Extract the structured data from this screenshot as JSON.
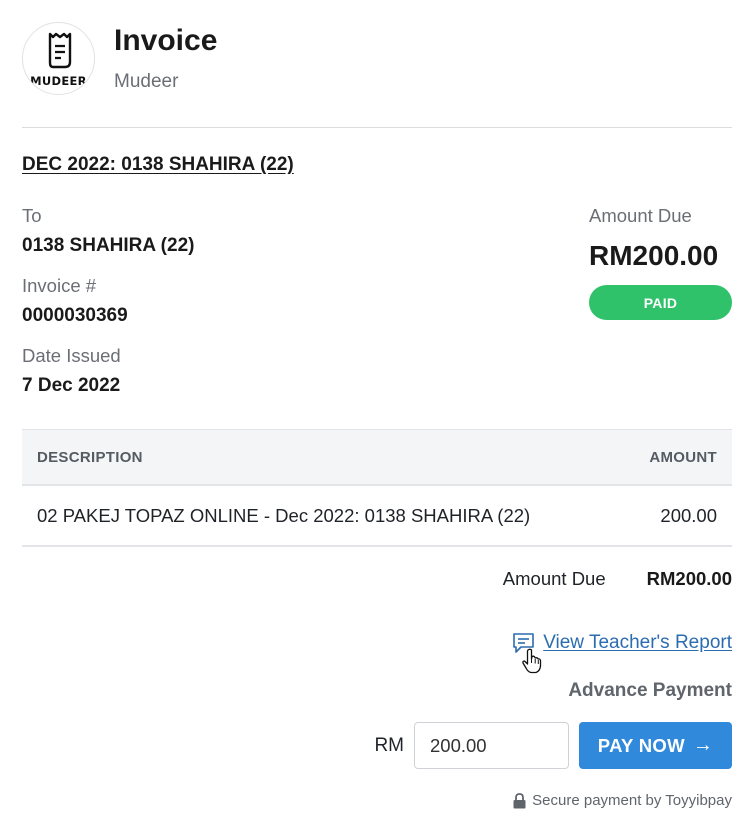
{
  "header": {
    "logo_text": "MUDEER",
    "title": "Invoice",
    "org_name": "Mudeer"
  },
  "invoice": {
    "heading_link": "DEC 2022: 0138 SHAHIRA (22)",
    "to_label": "To",
    "to_value": "0138 SHAHIRA (22)",
    "number_label": "Invoice #",
    "number_value": "0000030369",
    "date_label": "Date Issued",
    "date_value": "7 Dec 2022",
    "amount_due_label": "Amount Due",
    "amount_due_value": "RM200.00",
    "status": "PAID"
  },
  "table": {
    "columns": [
      "DESCRIPTION",
      "AMOUNT"
    ],
    "rows": [
      {
        "description": "02 PAKEJ TOPAZ ONLINE - Dec 2022: 0138 SHAHIRA (22)",
        "amount": "200.00"
      }
    ]
  },
  "summary": {
    "label": "Amount Due",
    "value": "RM200.00"
  },
  "teacher_report": {
    "label": "View Teacher's Report",
    "icon": "chat-icon"
  },
  "advance_payment": {
    "title": "Advance Payment",
    "currency_label": "RM",
    "input_value": "200.00",
    "button_label": "PAY NOW",
    "button_icon": "arrow-right-icon"
  },
  "secure_note": {
    "text": "Secure payment by Toyyibpay",
    "icon": "lock-icon"
  },
  "colors": {
    "paid_badge": "#2fc26b",
    "pay_button": "#3189db",
    "link": "#2b6cb0"
  }
}
